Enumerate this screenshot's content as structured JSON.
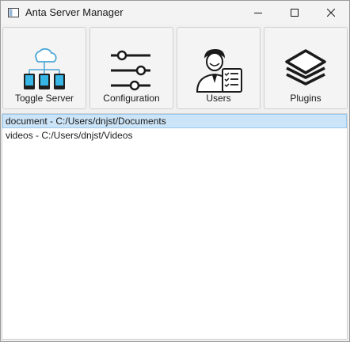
{
  "window": {
    "title": "Anta Server Manager"
  },
  "title_buttons": [
    {
      "name": "minimize",
      "icon": "minimize-icon"
    },
    {
      "name": "maximize",
      "icon": "maximize-icon"
    },
    {
      "name": "close",
      "icon": "close-icon"
    }
  ],
  "toolbar": {
    "buttons": [
      {
        "label": "Toggle Server",
        "icon": "cloud-network-icon"
      },
      {
        "label": "Configuration",
        "icon": "sliders-icon"
      },
      {
        "label": "Users",
        "icon": "user-checklist-icon"
      },
      {
        "label": "Plugins",
        "icon": "layers-icon"
      }
    ]
  },
  "shares": {
    "items": [
      {
        "text": "document - C:/Users/dnjst/Documents",
        "selected": true
      },
      {
        "text": "videos - C:/Users/dnjst/Videos",
        "selected": false
      }
    ]
  },
  "colors": {
    "selection_bg": "#cce4f7",
    "selection_border": "#99c9ef",
    "cloud_stroke": "#4aa6d6",
    "device_fill": "#37b6e6"
  }
}
